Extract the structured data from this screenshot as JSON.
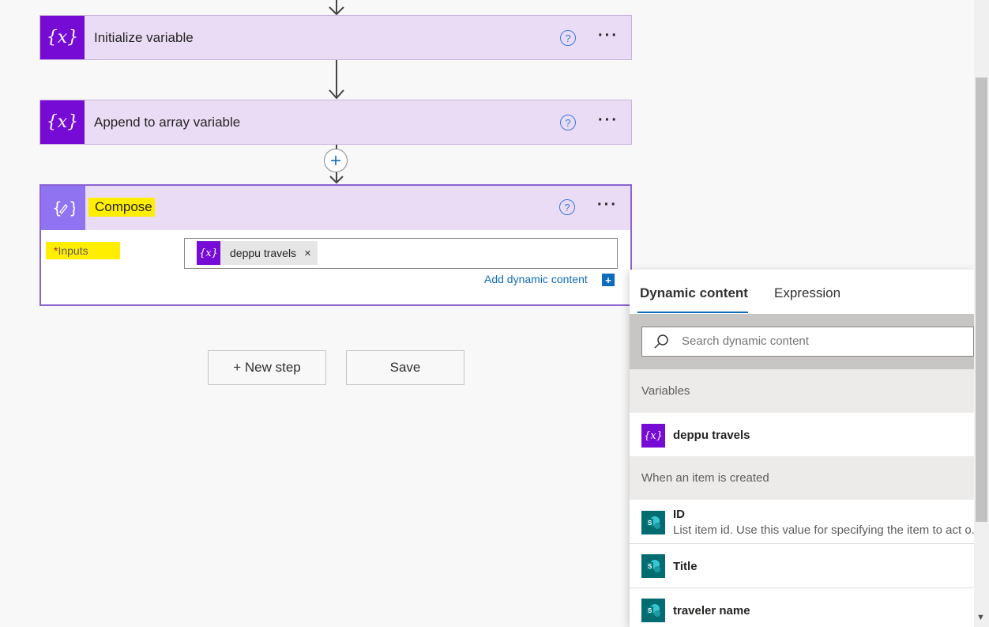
{
  "steps": [
    {
      "title": "Initialize variable",
      "icon": "variable-icon"
    },
    {
      "title": "Append to array variable",
      "icon": "variable-icon"
    }
  ],
  "compose": {
    "title": "Compose",
    "inputs_label": "Inputs",
    "required_mark": "*",
    "token": "deppu travels",
    "token_remove": "×",
    "add_dynamic": "Add dynamic content",
    "add_dynamic_btn": "+"
  },
  "buttons": {
    "new_step": "+ New step",
    "save": "Save"
  },
  "panel": {
    "tabs": [
      "Dynamic content",
      "Expression"
    ],
    "search_placeholder": "Search dynamic content",
    "sections": [
      {
        "header": "Variables",
        "items": [
          {
            "title": "deppu travels"
          }
        ]
      },
      {
        "header": "When an item is created",
        "items": [
          {
            "title": "ID",
            "desc": "List item id. Use this value for specifying the item to act o..."
          },
          {
            "title": "Title"
          },
          {
            "title": "traveler name"
          }
        ]
      }
    ]
  },
  "icons": {
    "variable_glyph": "{x}",
    "help_glyph": "?",
    "more_glyph": "···"
  },
  "colors": {
    "variable_purple": "#770bd6",
    "compose_purple": "#8f73f0",
    "card_bg": "#eadcf5",
    "highlight": "#ffee00",
    "link_blue": "#0f6cbd",
    "sharepoint_teal": "#036c70"
  }
}
